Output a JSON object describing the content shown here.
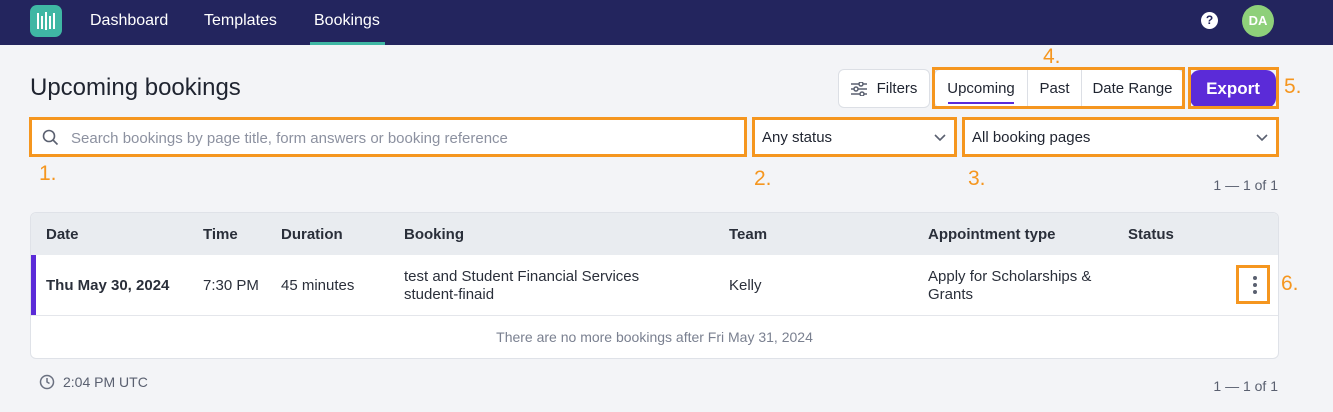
{
  "nav": {
    "items": [
      {
        "label": "Dashboard",
        "active": false
      },
      {
        "label": "Templates",
        "active": false
      },
      {
        "label": "Bookings",
        "active": true
      }
    ],
    "help_icon": "?",
    "avatar_initials": "DA"
  },
  "page": {
    "title": "Upcoming bookings"
  },
  "toolbar": {
    "filters_label": "Filters",
    "tabs": [
      {
        "label": "Upcoming",
        "active": true
      },
      {
        "label": "Past",
        "active": false
      },
      {
        "label": "Date Range",
        "active": false
      }
    ],
    "export_label": "Export"
  },
  "search": {
    "placeholder": "Search bookings by page title, form answers or booking reference"
  },
  "status_filter": {
    "value": "Any status"
  },
  "page_filter": {
    "value": "All booking pages"
  },
  "pagination": {
    "top": "1 — 1 of 1",
    "bottom": "1 — 1 of 1"
  },
  "table": {
    "headers": [
      "Date",
      "Time",
      "Duration",
      "Booking",
      "Team",
      "Appointment type",
      "Status"
    ],
    "rows": [
      {
        "date": "Thu May 30, 2024",
        "time": "7:30 PM",
        "duration": "45 minutes",
        "booking_title": "test and Student Financial Services",
        "booking_slug": "student-finaid",
        "team": "Kelly",
        "appointment_type": "Apply for Scholarships & Grants",
        "status": ""
      }
    ],
    "empty_message": "There are no more bookings after Fri May 31, 2024"
  },
  "timezone": "2:04 PM UTC",
  "annotations": [
    "1.",
    "2.",
    "3.",
    "4.",
    "5.",
    "6."
  ],
  "colors": {
    "nav_bg": "#23255e",
    "accent": "#5b2bd8",
    "annotation": "#f5961f",
    "logo": "#3fb7a4"
  }
}
